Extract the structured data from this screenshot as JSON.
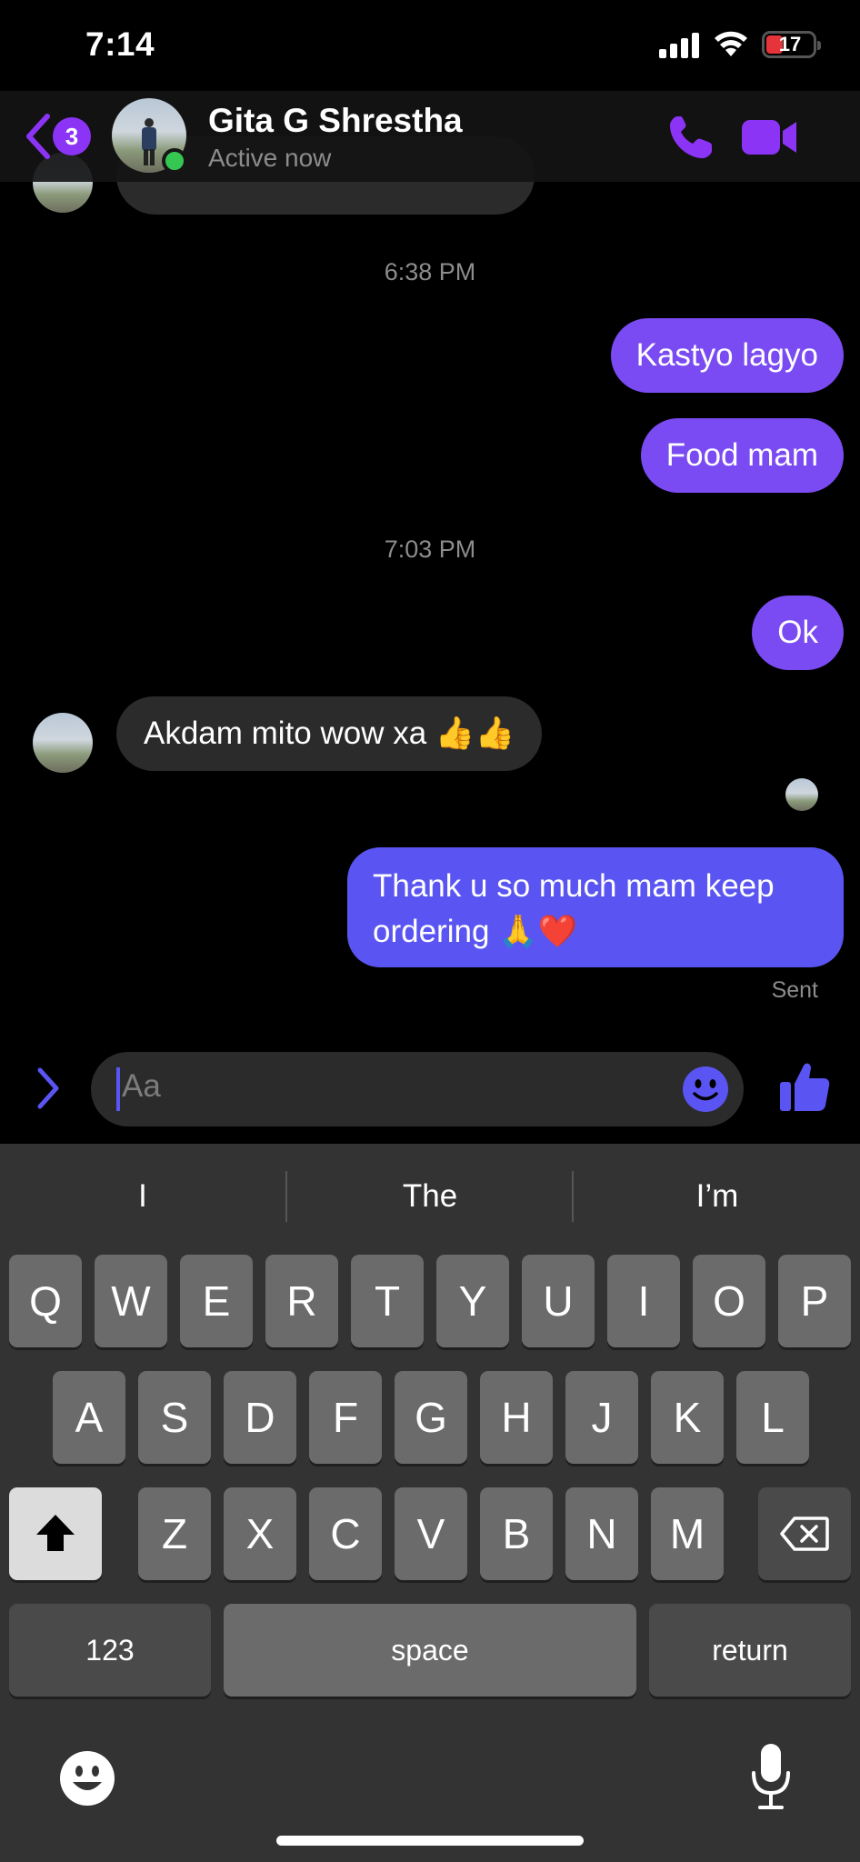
{
  "status_bar": {
    "time": "7:14",
    "battery_level": "17",
    "icons": [
      "signal-icon",
      "wifi-icon",
      "battery-icon"
    ]
  },
  "header": {
    "back_badge_count": "3",
    "contact_name": "Gita G Shrestha",
    "contact_status": "Active now",
    "icons": [
      "back-chevron-icon",
      "phone-call-icon",
      "video-call-icon"
    ],
    "accent_color": "#8b34f5"
  },
  "conversation": {
    "timestamp_1": "6:38 PM",
    "out_message_1": "Kastyo lagyo",
    "out_message_2": "Food mam",
    "timestamp_2": "7:03 PM",
    "out_message_3": "Ok",
    "in_message_1": "Akdam mito wow xa 👍👍",
    "out_message_4": "Thank u so much mam keep ordering 🙏❤️",
    "sent_label": "Sent",
    "outgoing_bubble_color": "#7a4bf2",
    "incoming_bubble_color": "#2b2b2b"
  },
  "composer": {
    "placeholder": "Aa",
    "icons": [
      "expand-chevron-icon",
      "smiley-icon",
      "thumbs-up-icon"
    ]
  },
  "keyboard": {
    "suggestions": [
      "I",
      "The",
      "I’m"
    ],
    "row1": [
      "Q",
      "W",
      "E",
      "R",
      "T",
      "Y",
      "U",
      "I",
      "O",
      "P"
    ],
    "row2": [
      "A",
      "S",
      "D",
      "F",
      "G",
      "H",
      "J",
      "K",
      "L"
    ],
    "row3": [
      "Z",
      "X",
      "C",
      "V",
      "B",
      "N",
      "M"
    ],
    "numbers_key": "123",
    "space_key": "space",
    "return_key": "return",
    "icons": [
      "shift-icon",
      "backspace-icon",
      "emoji-keyboard-icon",
      "microphone-icon"
    ]
  }
}
